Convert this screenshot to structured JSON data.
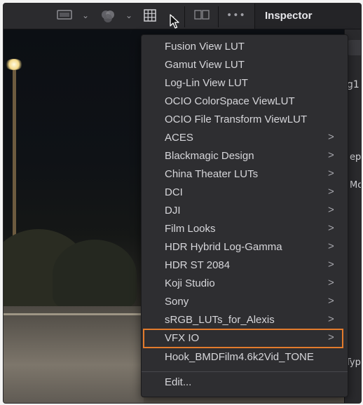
{
  "toolbar": {
    "viewer_options_icon": "monitor-icon",
    "color_icon": "color-wheel-icon",
    "lut_icon": "grid-icon",
    "split_icon": "split-view-icon",
    "more_label": "•••"
  },
  "inspector": {
    "title": "Inspector",
    "partial_texts": [
      "g1",
      "ept",
      "Mod",
      "Typ"
    ]
  },
  "lut_menu": {
    "items": [
      {
        "label": "Fusion View LUT",
        "submenu": false
      },
      {
        "label": "Gamut View LUT",
        "submenu": false
      },
      {
        "label": "Log-Lin View LUT",
        "submenu": false
      },
      {
        "label": "OCIO ColorSpace ViewLUT",
        "submenu": false
      },
      {
        "label": "OCIO File Transform ViewLUT",
        "submenu": false
      },
      {
        "label": "ACES",
        "submenu": true
      },
      {
        "label": "Blackmagic Design",
        "submenu": true
      },
      {
        "label": "China Theater LUTs",
        "submenu": true
      },
      {
        "label": "DCI",
        "submenu": true
      },
      {
        "label": "DJI",
        "submenu": true
      },
      {
        "label": "Film Looks",
        "submenu": true
      },
      {
        "label": "HDR Hybrid Log-Gamma",
        "submenu": true
      },
      {
        "label": "HDR ST 2084",
        "submenu": true
      },
      {
        "label": "Koji Studio",
        "submenu": true
      },
      {
        "label": "Sony",
        "submenu": true
      },
      {
        "label": "sRGB_LUTs_for_Alexis",
        "submenu": true
      },
      {
        "label": "VFX IO",
        "submenu": true,
        "highlighted": true
      },
      {
        "label": "Hook_BMDFilm4.6k2Vid_TONE",
        "submenu": false
      }
    ],
    "edit_label": "Edit...",
    "arrow": ">"
  },
  "colors": {
    "highlight_outline": "#e37b2c",
    "menu_bg": "#2e2e31",
    "menu_text": "#d6d6da"
  }
}
